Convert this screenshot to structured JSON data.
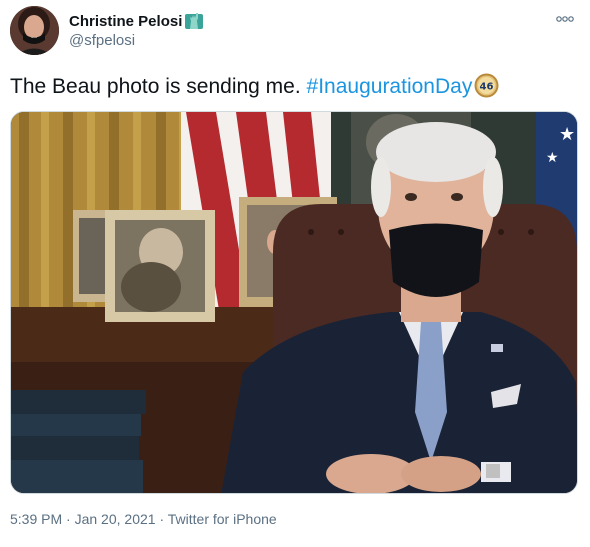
{
  "author": {
    "display_name": "Christine Pelosi",
    "handle": "@sfpelosi",
    "avatar_icon": "avatar-photo",
    "badge_icon": "statue-of-liberty-icon"
  },
  "tweet": {
    "text_before": "The Beau photo is sending me. ",
    "hashtag": "#InaugurationDay",
    "hashtag_emoji": "46",
    "media_alt": "photo"
  },
  "meta": {
    "time": "5:39 PM",
    "separator": "·",
    "date": "Jan 20, 2021",
    "source": "Twitter for iPhone"
  },
  "colors": {
    "link": "#1b95e0",
    "secondary_text": "#5b7083",
    "border": "#cfd9de"
  }
}
